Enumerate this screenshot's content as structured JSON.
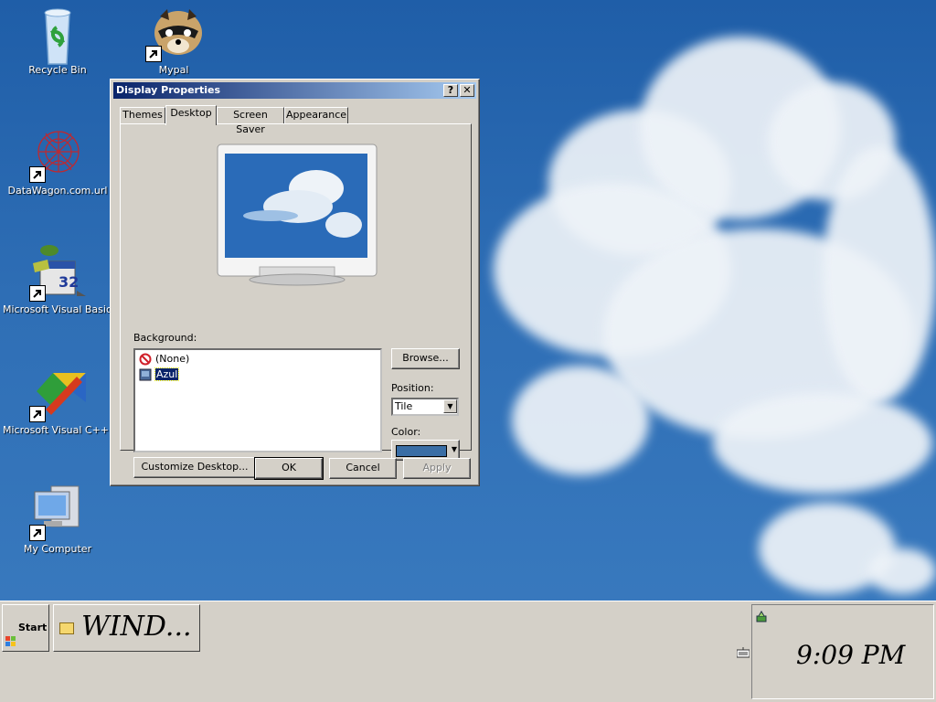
{
  "desktop": {
    "icons": [
      {
        "label": "Recycle Bin"
      },
      {
        "label": "Mypal"
      },
      {
        "label": "DataWagon.com.url"
      },
      {
        "label": "Microsoft Visual Basic 6.0"
      },
      {
        "label": "Microsoft Visual C++ 6.0"
      },
      {
        "label": "My Computer"
      }
    ],
    "vb_badge": "32"
  },
  "dialog": {
    "title": "Display Properties",
    "help_button": "?",
    "close_button": "✕",
    "tabs": [
      {
        "label": "Themes"
      },
      {
        "label": "Desktop"
      },
      {
        "label": "Screen Saver"
      },
      {
        "label": "Appearance"
      }
    ],
    "active_tab": "Desktop",
    "background_label": "Background:",
    "background_items": [
      {
        "label": "(None)",
        "icon": "no-symbol-icon"
      },
      {
        "label": "Azul",
        "icon": "bitmap-icon",
        "selected": true
      }
    ],
    "browse_button": "Browse...",
    "position_label": "Position:",
    "position_value": "Tile",
    "color_label": "Color:",
    "color_value": "#3a6ea5",
    "customize_button": "Customize Desktop...",
    "ok_button": "OK",
    "cancel_button": "Cancel",
    "apply_button": "Apply"
  },
  "taskbar": {
    "start_label": "Start",
    "task_label": "WIND...",
    "clock": "9:09 PM"
  }
}
